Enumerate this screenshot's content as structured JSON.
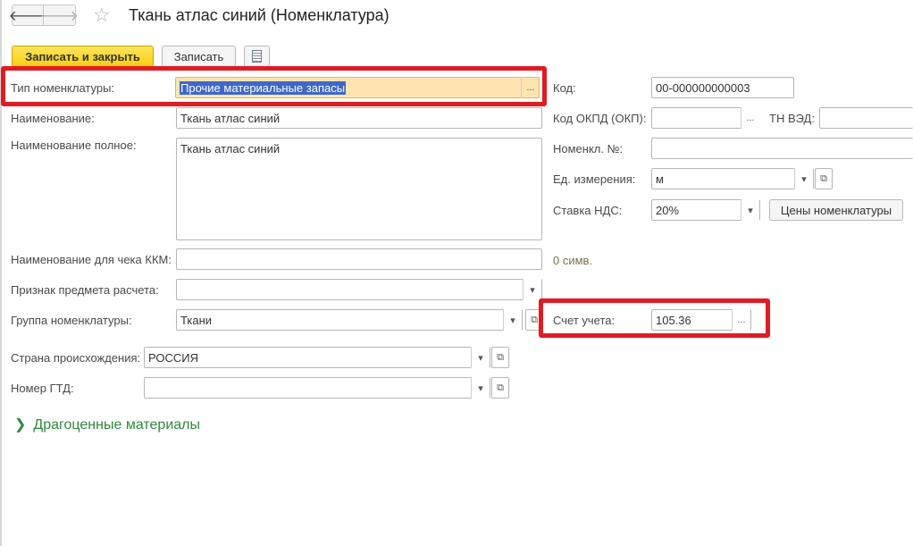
{
  "window": {
    "title": "Ткань атлас синий (Номенклатура)",
    "back_icon": "arrow-left-icon",
    "forward_icon": "arrow-right-icon",
    "favorite_icon": "star-icon"
  },
  "toolbar": {
    "save_close_label": "Записать и закрыть",
    "save_label": "Записать",
    "report_icon": "document-icon"
  },
  "form": {
    "type": {
      "label": "Тип номенклатуры:",
      "value": "Прочие материальные запасы",
      "btn": "..."
    },
    "name": {
      "label": "Наименование:",
      "value": "Ткань атлас синий"
    },
    "full_name": {
      "label": "Наименование полное:",
      "value": "Ткань атлас синий"
    },
    "receipt_name": {
      "label": "Наименование для чека ККМ:",
      "value": "",
      "hint": "0 симв."
    },
    "payment_subject": {
      "label": "Признак предмета расчета:",
      "value": ""
    },
    "group": {
      "label": "Группа номенклатуры:",
      "value": "Ткани"
    },
    "country": {
      "label": "Страна происхождения:",
      "value": "РОССИЯ"
    },
    "gtd": {
      "label": "Номер ГТД:",
      "value": ""
    },
    "code": {
      "label": "Код:",
      "value": "00-000000000003"
    },
    "okpd": {
      "label": "Код ОКПД (ОКП):",
      "value": "",
      "btn": "..."
    },
    "tnved": {
      "label": "ТН ВЭД:",
      "value": ""
    },
    "article": {
      "label": "Номенкл. №:",
      "value": ""
    },
    "unit": {
      "label": "Ед. измерения:",
      "value": "м"
    },
    "vat": {
      "label": "Ставка НДС:",
      "value": "20%"
    },
    "prices_button": "Цены номенклатуры",
    "account": {
      "label": "Счет учета:",
      "value": "105.36",
      "btn": "..."
    }
  },
  "sections": {
    "precious": "Драгоценные материалы"
  },
  "colors": {
    "accent_yellow": "#f7cf13",
    "highlight_red": "#e01b22",
    "group_green": "#2f8a3c"
  }
}
